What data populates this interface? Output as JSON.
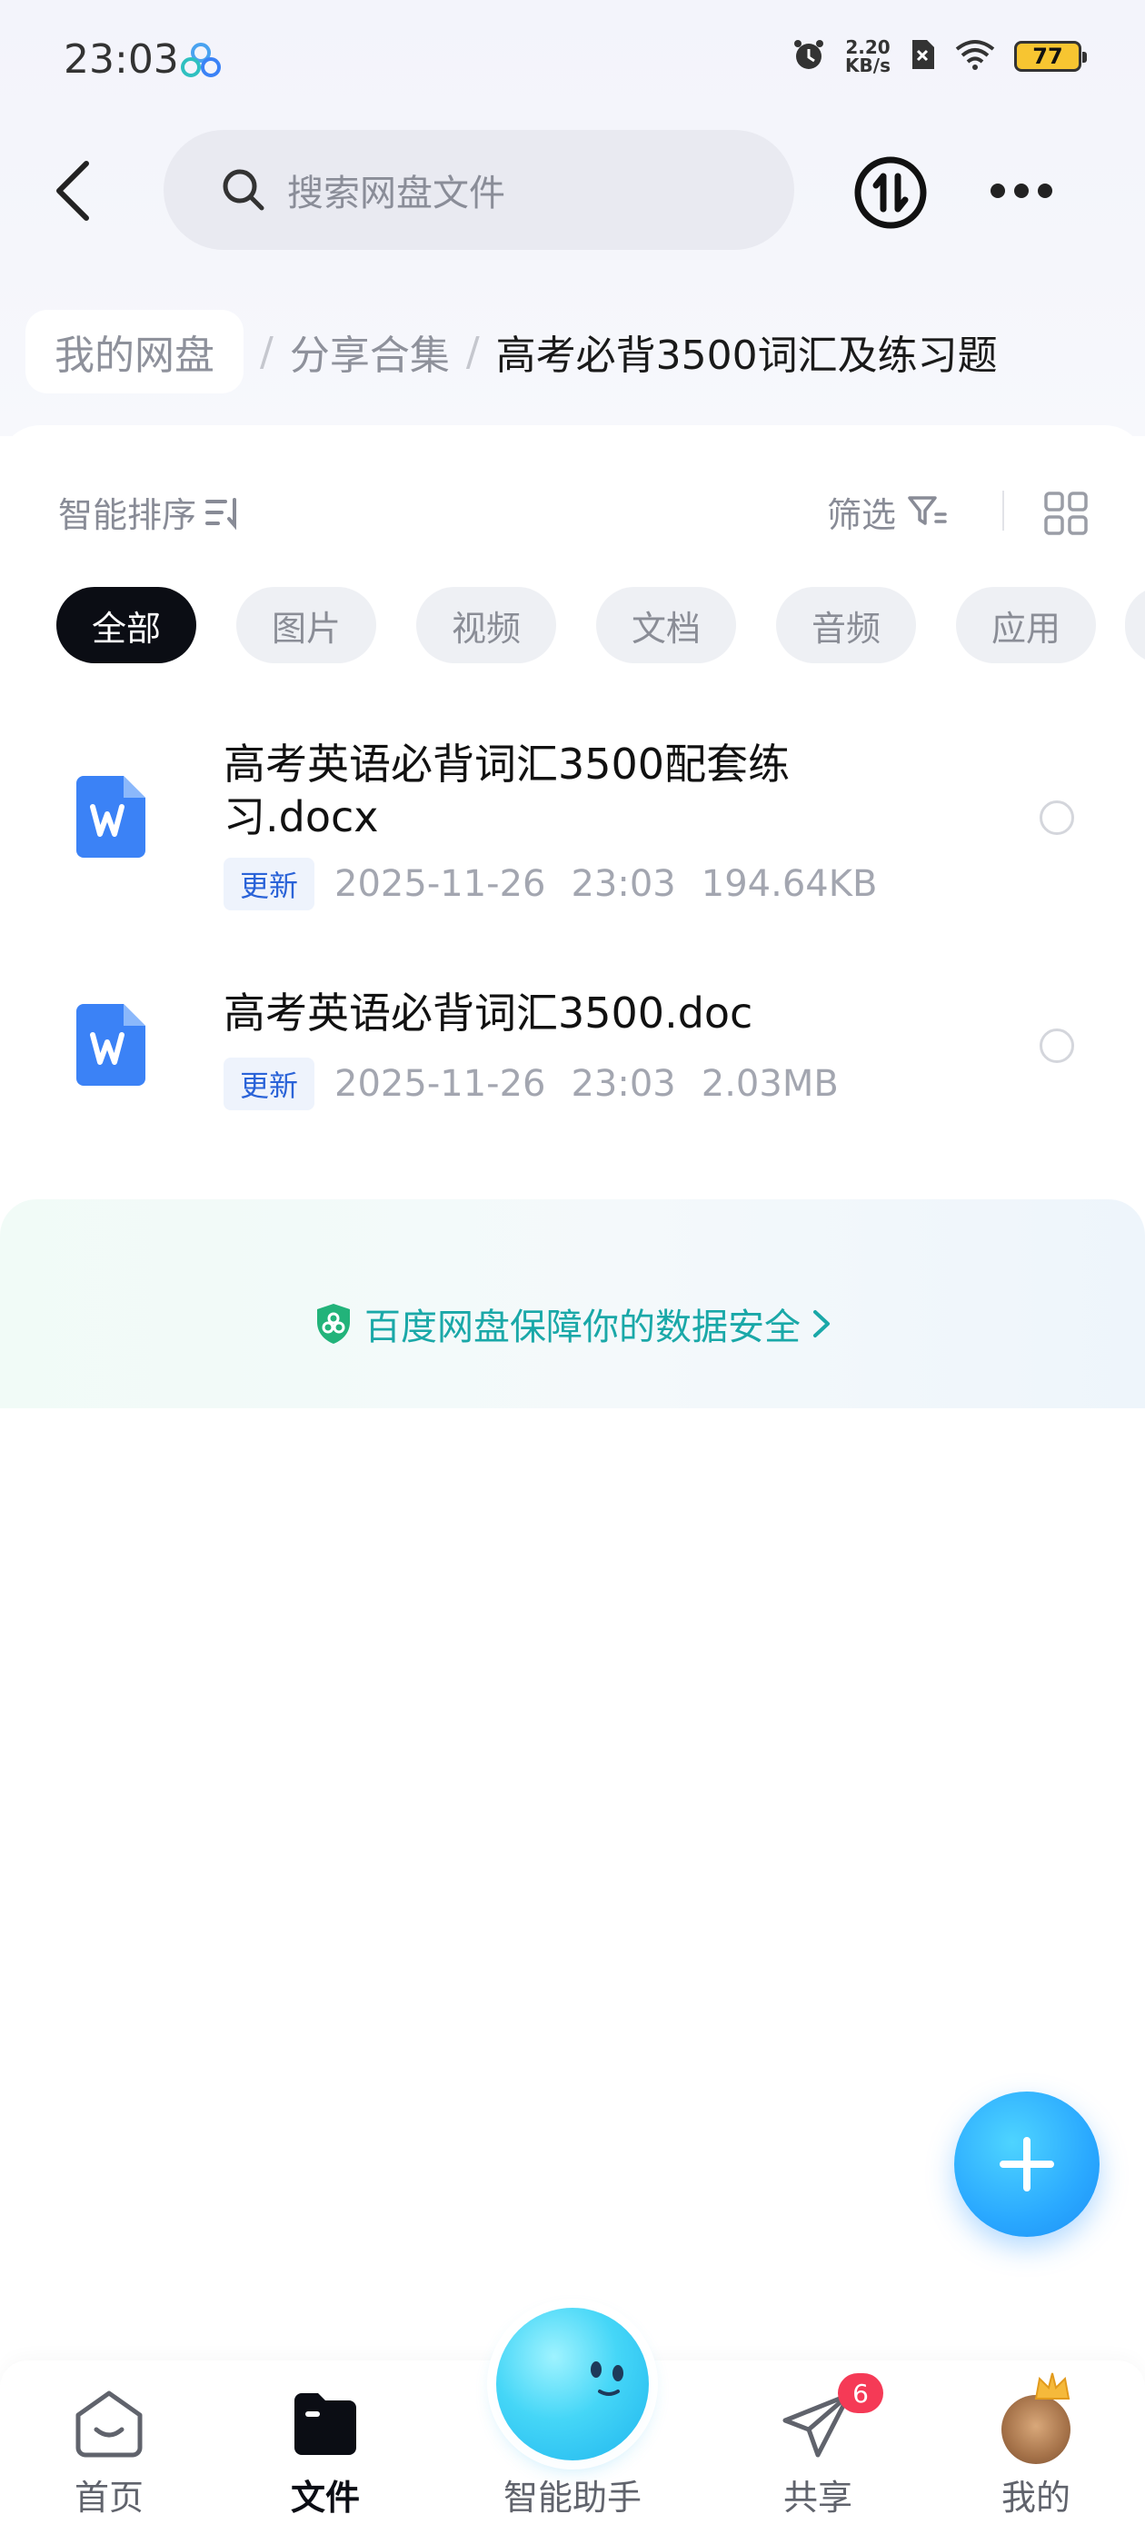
{
  "status_bar": {
    "time": "23:03",
    "net_speed_value": "2.20",
    "net_speed_unit": "KB/s",
    "battery": "77",
    "icons": [
      "baidu-netdisk-icon",
      "alarm-icon",
      "sim-disabled-icon",
      "wifi-icon",
      "battery-icon"
    ]
  },
  "header": {
    "search_placeholder": "搜索网盘文件",
    "icons": [
      "back-icon",
      "search-icon",
      "transfer-icon",
      "more-icon"
    ]
  },
  "breadcrumb": {
    "root": "我的网盘",
    "separator": "/",
    "middle": "分享合集",
    "current": "高考必背3500词汇及练习题"
  },
  "toolbar": {
    "sort_label": "智能排序",
    "filter_label": "筛选"
  },
  "tabs": [
    {
      "label": "全部",
      "active": true
    },
    {
      "label": "图片",
      "active": false
    },
    {
      "label": "视频",
      "active": false
    },
    {
      "label": "文档",
      "active": false
    },
    {
      "label": "音频",
      "active": false
    },
    {
      "label": "应用",
      "active": false
    }
  ],
  "files": [
    {
      "name": "高考英语必背词汇3500配套练习.docx",
      "badge": "更新",
      "date": "2025-11-26",
      "time": "23:03",
      "size": "194.64KB"
    },
    {
      "name": "高考英语必背词汇3500.doc",
      "badge": "更新",
      "date": "2025-11-26",
      "time": "23:03",
      "size": "2.03MB"
    }
  ],
  "security": {
    "text": "百度网盘保障你的数据安全"
  },
  "bottom_nav": {
    "items": [
      {
        "label": "首页",
        "active": false
      },
      {
        "label": "文件",
        "active": true
      },
      {
        "label": "智能助手",
        "active": false
      },
      {
        "label": "共享",
        "active": false
      },
      {
        "label": "我的",
        "active": false
      }
    ],
    "share_badge": "6"
  },
  "colors": {
    "accent_blue": "#2a63d8",
    "security_teal": "#1aa8a8",
    "active_tab": "#0b0d14",
    "badge_red": "#f53a56",
    "fab_blue": "#2aa9ff",
    "word_icon_blue": "#3b82f6"
  }
}
